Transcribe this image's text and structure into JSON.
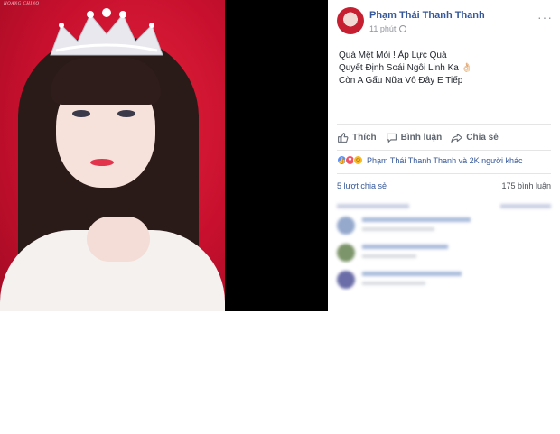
{
  "post": {
    "author": "Phạm Thái Thanh Thanh",
    "time": "11 phút",
    "menu_glyph": "···",
    "caption_lines": [
      "Quá Mệt Mỏi ! Áp Lực Quá",
      "Quyết Định Soái Ngôi Linh Ka 👌🏻",
      "Còn A Gấu Nữa Vô Đây E Tiếp"
    ],
    "actions": {
      "like": "Thích",
      "comment": "Bình luận",
      "share": "Chia sẻ"
    },
    "reactions_text": "Phạm Thái Thanh Thanh và 2K người khác",
    "reaction_icons": [
      "like-icon",
      "love-icon",
      "haha-icon"
    ],
    "shares_text": "5 lượt chia sẻ",
    "comments_count_text": "175 bình luận"
  },
  "photo": {
    "watermark": "HOANG CHINO"
  },
  "colors": {
    "link": "#365899",
    "photo_background": "#c8102e",
    "viewer_background": "#000000"
  }
}
